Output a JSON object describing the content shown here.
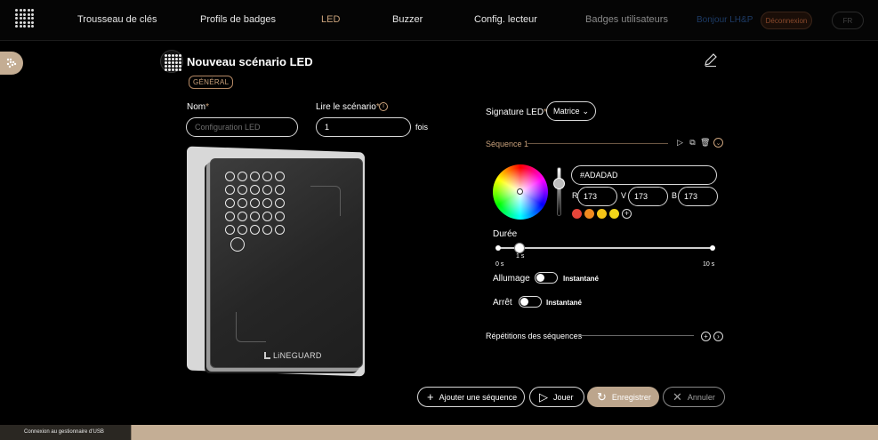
{
  "nav": {
    "items": [
      {
        "label": "Trousseau de clés",
        "state": "normal"
      },
      {
        "label": "Profils de badges",
        "state": "normal"
      },
      {
        "label": "LED",
        "state": "active"
      },
      {
        "label": "Buzzer",
        "state": "normal"
      },
      {
        "label": "Config. lecteur",
        "state": "normal"
      },
      {
        "label": "Badges utilisateurs",
        "state": "dim"
      }
    ],
    "link": "Bonjour LH&P",
    "logout": "Déconnexion",
    "lang": "FR"
  },
  "header": {
    "title": "Nouveau scénario LED",
    "badge": "GÉNÉRAL"
  },
  "form": {
    "name_label": "Nom",
    "name_placeholder": "Configuration LED",
    "read_label": "Lire le scénario",
    "read_value": "1",
    "times": "fois"
  },
  "device": {
    "brand": "LiNEGUARD"
  },
  "led": {
    "signature_label": "Signature LED",
    "signature_value": "Matrice",
    "sequence_label": "Séquence 1",
    "hex": "#ADADAD",
    "r_label": "R",
    "r": "173",
    "g_label": "V",
    "g": "173",
    "b_label": "B",
    "b": "173",
    "swatches": [
      "#e5453a",
      "#f08a1f",
      "#f4c417",
      "#f1d51a"
    ],
    "duration_label": "Durée",
    "duration_value": "1 s",
    "duration_min": "0 s",
    "duration_max": "10 s",
    "on_label": "Allumage",
    "on_mode": "Instantané",
    "off_label": "Arrêt",
    "off_mode": "Instantané",
    "repetitions_label": "Répétitions des séquences"
  },
  "actions": {
    "add_sequence": "Ajouter une séquence",
    "play": "Jouer",
    "save": "Enregistrer",
    "cancel": "Annuler"
  },
  "status": {
    "text": "Connexion au gestionnaire d'USB"
  }
}
